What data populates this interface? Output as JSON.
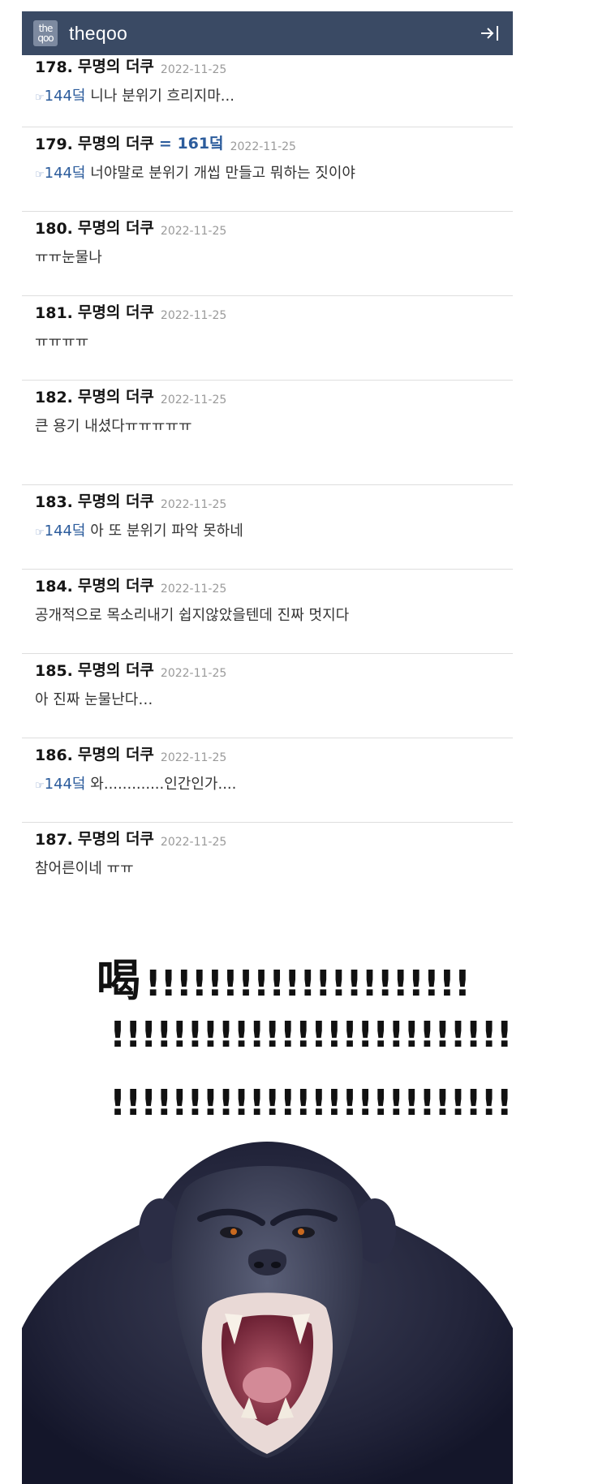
{
  "header": {
    "logo_top": "the",
    "logo_bottom": "qoo",
    "brand": "theqoo",
    "login_icon": "login-arrow-icon"
  },
  "comments": [
    {
      "num": "178.",
      "writer": "무명의 더쿠",
      "date": "2022-11-25",
      "hand": "☞",
      "mention": "144덬",
      "text": " 니나 분위기 흐리지마..."
    },
    {
      "num": "179.",
      "writer": "무명의 더쿠",
      "reply": "= 161덬",
      "date": "2022-11-25",
      "hand": "☞",
      "mention": "144덬",
      "text": " 너야말로 분위기 개씹 만들고 뭐하는 짓이야"
    },
    {
      "num": "180.",
      "writer": "무명의 더쿠",
      "date": "2022-11-25",
      "text": "ㅠㅠ눈물나"
    },
    {
      "num": "181.",
      "writer": "무명의 더쿠",
      "date": "2022-11-25",
      "text": "ㅠㅠㅠㅠ"
    },
    {
      "num": "182.",
      "writer": "무명의 더쿠",
      "date": "2022-11-25",
      "text": "큰 용기 내셨다ㅠㅠㅠㅠㅠ"
    },
    {
      "num": "183.",
      "writer": "무명의 더쿠",
      "date": "2022-11-25",
      "hand": "☞",
      "mention": "144덬",
      "text": " 아 또 분위기 파악 못하네"
    },
    {
      "num": "184.",
      "writer": "무명의 더쿠",
      "date": "2022-11-25",
      "text": "공개적으로 목소리내기 쉽지않았을텐데 진짜 멋지다"
    },
    {
      "num": "185.",
      "writer": "무명의 더쿠",
      "date": "2022-11-25",
      "text": "아 진짜 눈물난다…"
    },
    {
      "num": "186.",
      "writer": "무명의 더쿠",
      "date": "2022-11-25",
      "hand": "☞",
      "mention": "144덬",
      "text": " 와.............인간인가...."
    },
    {
      "num": "187.",
      "writer": "무명의 더쿠",
      "date": "2022-11-25",
      "text": "참어른이네 ㅠㅠ"
    }
  ],
  "meme": {
    "shout_char": "喝",
    "line1": "!!!!!!!!!!!!!!!!!!!!!",
    "line2": "!!!!!!!!!!!!!!!!!!!!!!!!!!",
    "line3": "!!!!!!!!!!!!!!!!!!!!!!!!!!!",
    "image": "screaming-chimpanzee"
  },
  "colors": {
    "header_bg": "#3a4a64",
    "mention": "#2c5c9c",
    "date": "#9a9a9a",
    "divider": "#dedede"
  }
}
